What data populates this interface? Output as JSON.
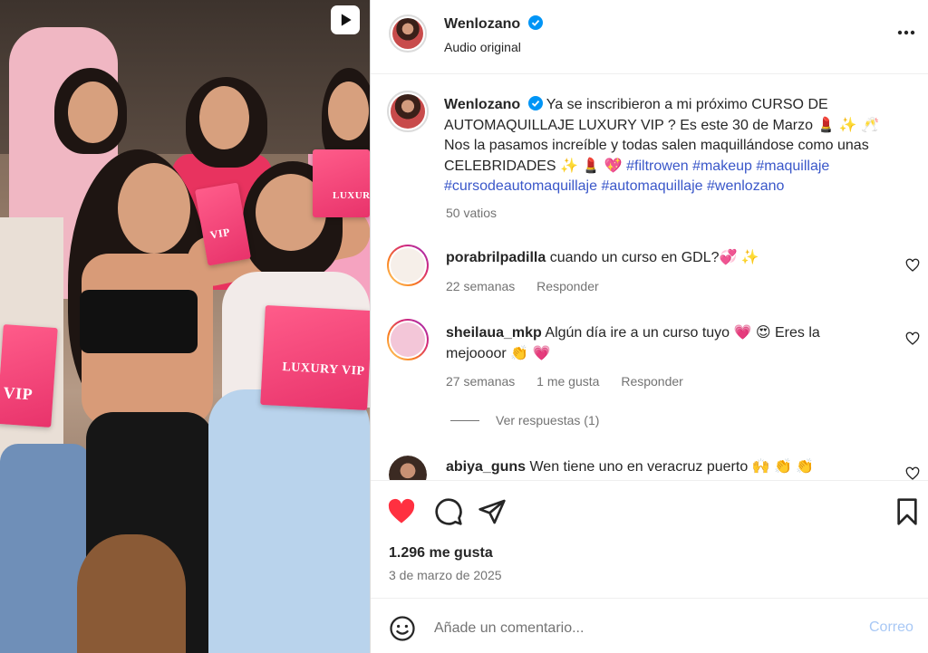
{
  "post": {
    "username": "Wenlozano",
    "audio": "Audio original",
    "caption_text": "Ya se inscribieron a mi próximo CURSO DE AUTOMAQUILLAJE LUXURY VIP ? Es este 30 de Marzo 💄 ✨ 🥂 Nos la pasamos increíble y todas salen maquillándose como unas CELEBRIDADES ✨ 💄 💖 ",
    "hashtags": [
      "#filtrowen",
      "#makeup",
      "#maquillaje",
      "#cursodeautomaquillaje",
      "#automaquillaje",
      "#wenlozano"
    ],
    "caption_meta": "50 vatios",
    "likes": "1.296 me gusta",
    "date": "3 de marzo de 2025"
  },
  "media": {
    "paper_text_1": "LUXURY",
    "paper_text_2": "VIP",
    "paper_text_3": "LUXURY VIP",
    "paper_text_4": "VIP"
  },
  "comments": [
    {
      "username": "porabrilpadilla",
      "text": "cuando un curso en GDL?💞 ✨",
      "time": "22 semanas",
      "reply": "Responder"
    },
    {
      "username": "sheilaua_mkp",
      "text": "Algún día ire a un curso tuyo 💗 😍 Eres la mejoooor 👏 💗",
      "time": "27 semanas",
      "likes": "1 me gusta",
      "reply": "Responder"
    },
    {
      "username": "abiya_guns",
      "text": "Wen tiene uno en veracruz puerto 🙌 👏 👏"
    }
  ],
  "view_replies": "Ver respuestas (1)",
  "comment_box": {
    "placeholder": "Añade un comentario...",
    "post_label": "Correo"
  },
  "icons": [
    "reel-icon",
    "verified-icon",
    "more-icon",
    "heart-icon",
    "comment-icon",
    "share-icon",
    "bookmark-icon",
    "emoji-icon"
  ],
  "colors": {
    "like_red": "#ff3040",
    "link_blue": "#3a57c9",
    "verified_blue": "#0095f6",
    "post_disabled": "#a8c8f5"
  }
}
